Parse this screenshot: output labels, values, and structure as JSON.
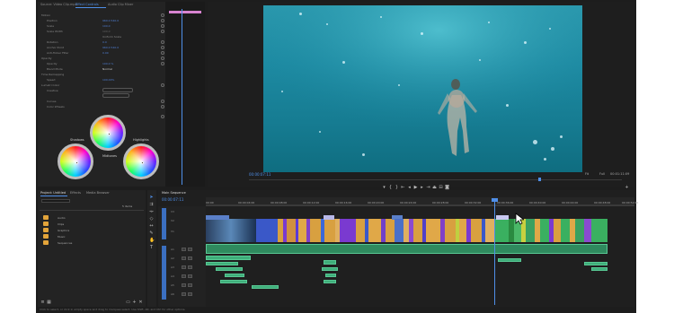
{
  "effect_controls": {
    "tabs": [
      "Source: Video Clip.mp4",
      "Effect Controls",
      "Audio Clip Mixer"
    ],
    "properties": [
      {
        "label": "Motion",
        "value": ""
      },
      {
        "label": "Position",
        "value": "960.0  540.0"
      },
      {
        "label": "Scale",
        "value": "100.0"
      },
      {
        "label": "Scale Width",
        "value": "100.0"
      },
      {
        "label": "Uniform Scale",
        "value": ""
      },
      {
        "label": "Rotation",
        "value": "0.0"
      },
      {
        "label": "Anchor Point",
        "value": "960.0  540.0"
      },
      {
        "label": "Anti-flicker Filter",
        "value": "0.00"
      },
      {
        "label": "Opacity",
        "value": ""
      },
      {
        "label": "Opacity",
        "value": "100.0 %"
      },
      {
        "label": "Blend Mode",
        "value": "Normal"
      },
      {
        "label": "Time Remapping",
        "value": ""
      },
      {
        "label": "Speed",
        "value": "100.00%"
      },
      {
        "label": "Lumetri Color",
        "value": ""
      },
      {
        "label": "Creative",
        "value": ""
      },
      {
        "label": "Curves",
        "value": ""
      },
      {
        "label": "Color Wheels",
        "value": ""
      }
    ],
    "wheel_labels": [
      "Shadows",
      "Midtones",
      "Highlights"
    ],
    "timecode": "00:00:07:11"
  },
  "program_monitor": {
    "timecode": "00:00:07:11",
    "fit": "Fit",
    "resolution": "Full",
    "duration": "00:01:11:09"
  },
  "project_panel": {
    "tabs": [
      "Project: Untitled",
      "Effects",
      "Media Browser"
    ],
    "search_placeholder": "",
    "item_count": "5 items",
    "folders": [
      "Audio",
      "Clips",
      "Graphics",
      "Music",
      "Sequences"
    ]
  },
  "timeline": {
    "tab": "Main Sequence",
    "timecode": "00:00:07:11",
    "ruler": [
      "00:00",
      "00:00:04:00",
      "00:00:08:00",
      "00:00:12:00",
      "00:00:16:00",
      "00:00:20:00",
      "00:00:24:00",
      "00:00:28:00",
      "00:00:32:00",
      "00:00:36:00",
      "00:00:40:00",
      "00:00:44:00",
      "00:00:48:00",
      "00:00:52:00"
    ],
    "video_tracks": [
      "V3",
      "V2",
      "V1"
    ],
    "audio_tracks": [
      "A1",
      "A2",
      "A3",
      "A4",
      "A5",
      "A6"
    ]
  },
  "status_bar": {
    "text": "Click to select, or click in empty space and drag to marquee select. Use Shift, Alt, and Ctrl for other options."
  },
  "colors": {
    "accent_blue": "#4f8fe8",
    "audio_green": "#3fae7a",
    "folder": "#e3a43a",
    "playhead": "#4f8fe8"
  }
}
